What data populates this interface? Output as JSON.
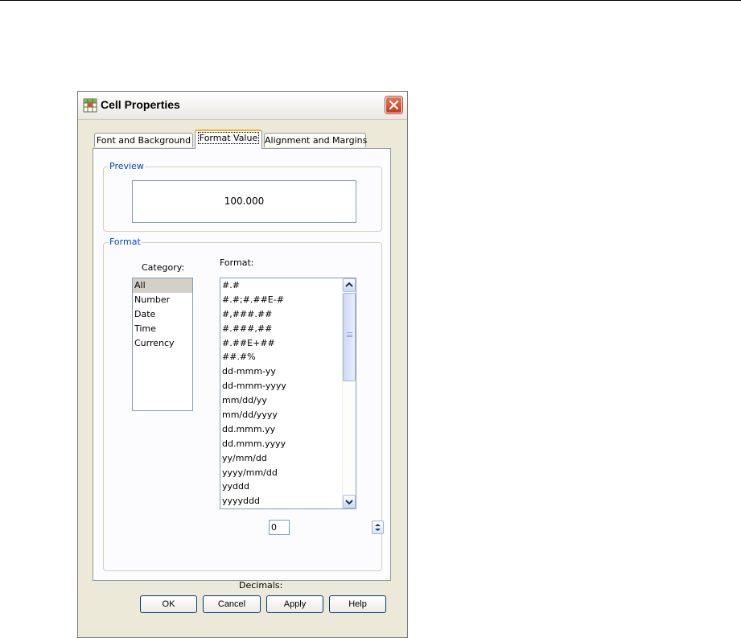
{
  "dialog": {
    "title": "Cell Properties",
    "icon": "cell-properties-icon",
    "close_icon": "close-icon"
  },
  "tabs": [
    {
      "label": "Font and Background",
      "active": false
    },
    {
      "label": "Format Value",
      "active": true
    },
    {
      "label": "Alignment and Margins",
      "active": false
    }
  ],
  "preview": {
    "legend": "Preview",
    "value": "100.000"
  },
  "format_group": {
    "legend": "Format",
    "category_label": "Category:",
    "format_label": "Format:",
    "categories": [
      "All",
      "Number",
      "Date",
      "Time",
      "Currency"
    ],
    "selected_category": "All",
    "formats": [
      "#.#",
      "#.#;#.##E-#",
      "#,###.##",
      "#.###,##",
      "#.##E+##",
      "##.#%",
      "dd-mmm-yy",
      "dd-mmm-yyyy",
      "mm/dd/yy",
      "mm/dd/yyyy",
      "dd.mmm.yy",
      "dd.mmm.yyyy",
      "yy/mm/dd",
      "yyyy/mm/dd",
      "yyddd",
      "yyyyddd"
    ],
    "decimals_label": "Decimals:",
    "decimals_value": "0"
  },
  "buttons": {
    "ok": "OK",
    "cancel": "Cancel",
    "apply": "Apply",
    "help": "Help"
  },
  "colors": {
    "title_close": "#c6391b",
    "legend_text": "#0046d5",
    "active_tab_accent": "#f4ac2a",
    "dialog_bg": "#ece9d8"
  }
}
